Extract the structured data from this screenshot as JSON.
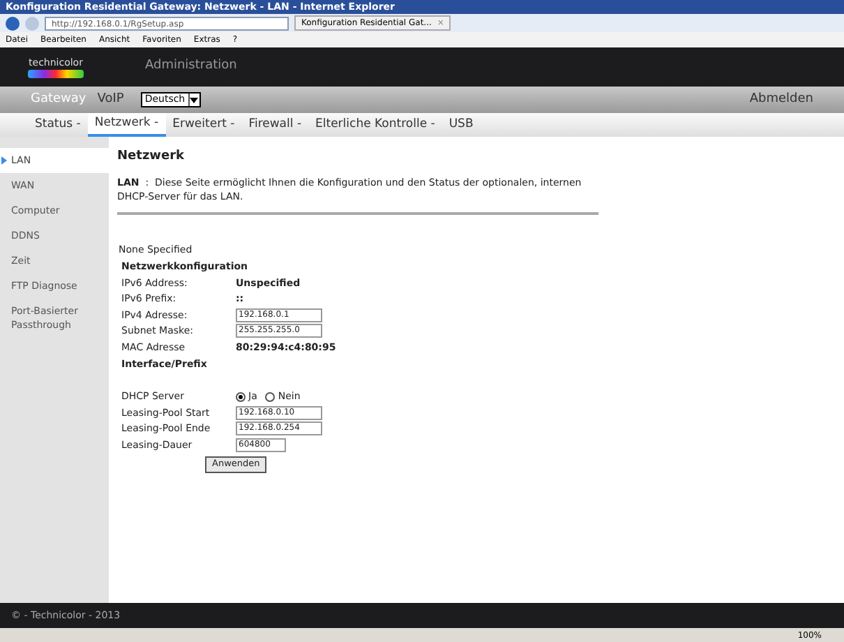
{
  "window": {
    "title": "Konfiguration Residential Gateway: Netzwerk - LAN - Internet Explorer",
    "address": "http://192.168.0.1/RgSetup.asp",
    "tab_title": "Konfiguration Residential Gat...",
    "tab_close": "×"
  },
  "menu": [
    "Datei",
    "Bearbeiten",
    "Ansicht",
    "Favoriten",
    "Extras",
    "?"
  ],
  "header": {
    "logo": "technicolor",
    "title": "Administration"
  },
  "top_nav": [
    {
      "label": "Gateway",
      "selected": true
    },
    {
      "label": "VoIP",
      "selected": false
    }
  ],
  "language": "Deutsch",
  "logout": "Abmelden",
  "tabs": [
    {
      "label": "Status -",
      "selected": false
    },
    {
      "label": "Netzwerk -",
      "selected": true
    },
    {
      "label": "Erweitert -",
      "selected": false
    },
    {
      "label": "Firewall -",
      "selected": false
    },
    {
      "label": "Elterliche Kontrolle -",
      "selected": false
    },
    {
      "label": "USB",
      "selected": false
    }
  ],
  "sidebar": [
    {
      "label": "LAN",
      "selected": true
    },
    {
      "label": "WAN",
      "selected": false
    },
    {
      "label": "Computer",
      "selected": false
    },
    {
      "label": "DDNS",
      "selected": false
    },
    {
      "label": "Zeit",
      "selected": false
    },
    {
      "label": "FTP Diagnose",
      "selected": false
    },
    {
      "label": "Port-Basierter Passthrough",
      "selected": false
    }
  ],
  "page": {
    "title": "Netzwerk",
    "intro": "**LAN**  :  Diese Seite ermöglicht Ihnen die Konfiguration und den Status der optionalen, internen DHCP-Server für das LAN.",
    "none": "None Specified"
  },
  "rows": [
    {
      "kind": "heading",
      "label": "Netzwerkkonfiguration"
    },
    {
      "kind": "value",
      "label": "IPv6 Address:",
      "value": "Unspecified"
    },
    {
      "kind": "value",
      "label": "IPv6 Prefix:",
      "value": "::"
    },
    {
      "kind": "input",
      "label": "IPv4 Adresse:",
      "value": "192.168.0.1"
    },
    {
      "kind": "input",
      "label": "Subnet Maske:",
      "value": "255.255.255.0"
    },
    {
      "kind": "value",
      "label": "MAC Adresse",
      "value": "80:29:94:c4:80:95"
    },
    {
      "kind": "heading",
      "label": "Interface/Prefix"
    },
    {
      "kind": "spacer"
    },
    {
      "kind": "radio",
      "label": "DHCP Server",
      "options": [
        {
          "label": "Ja",
          "selected": true
        },
        {
          "label": "Nein",
          "selected": false
        }
      ]
    },
    {
      "kind": "input",
      "label": "Leasing-Pool Start",
      "value": "192.168.0.10"
    },
    {
      "kind": "input",
      "label": "Leasing-Pool Ende",
      "value": "192.168.0.254"
    },
    {
      "kind": "short_input",
      "label": "Leasing-Dauer",
      "value": "604800"
    }
  ],
  "apply": "Anwenden",
  "footer": "© - Technicolor - 2013",
  "zoom": "100%"
}
